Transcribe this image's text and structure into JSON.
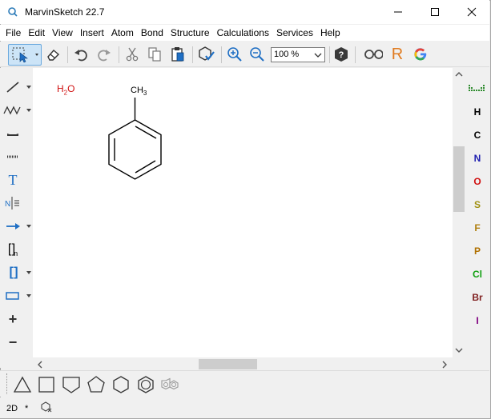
{
  "window": {
    "title": "MarvinSketch 22.7",
    "controls": [
      "minimize",
      "maximize",
      "close"
    ]
  },
  "menu": [
    "File",
    "Edit",
    "View",
    "Insert",
    "Atom",
    "Bond",
    "Structure",
    "Calculations",
    "Services",
    "Help"
  ],
  "toolbar": {
    "zoom_value": "100 %",
    "icons": [
      "selection-tool-icon",
      "eraser-icon",
      "undo-icon",
      "redo-icon",
      "cut-icon",
      "copy-icon",
      "paste-icon",
      "clean-structure-icon",
      "zoom-in-icon",
      "zoom-out-icon",
      "help-icon",
      "3d-view-icon",
      "r-group-icon",
      "google-search-icon"
    ],
    "rgroup_label": "R",
    "accent": "#1f6fc4"
  },
  "left_tools": {
    "text_tool_label": "T",
    "bracket_label": "[ ]",
    "bracket_subscript": "n",
    "charge_plus": "+",
    "charge_minus": "−"
  },
  "canvas": {
    "water_label_main": "H",
    "water_sub": "2",
    "water_label_end": "O",
    "water_color": "#d01010",
    "methyl_label_main": "CH",
    "methyl_sub": "3"
  },
  "atoms": [
    {
      "symbol": "H",
      "color": "#000000"
    },
    {
      "symbol": "C",
      "color": "#000000"
    },
    {
      "symbol": "N",
      "color": "#2020b0"
    },
    {
      "symbol": "O",
      "color": "#d01010"
    },
    {
      "symbol": "S",
      "color": "#a09010"
    },
    {
      "symbol": "F",
      "color": "#b08010"
    },
    {
      "symbol": "P",
      "color": "#b07000"
    },
    {
      "symbol": "Cl",
      "color": "#10a010"
    },
    {
      "symbol": "Br",
      "color": "#802020"
    },
    {
      "symbol": "I",
      "color": "#800080"
    }
  ],
  "status": {
    "mode": "2D",
    "modified": "*"
  }
}
